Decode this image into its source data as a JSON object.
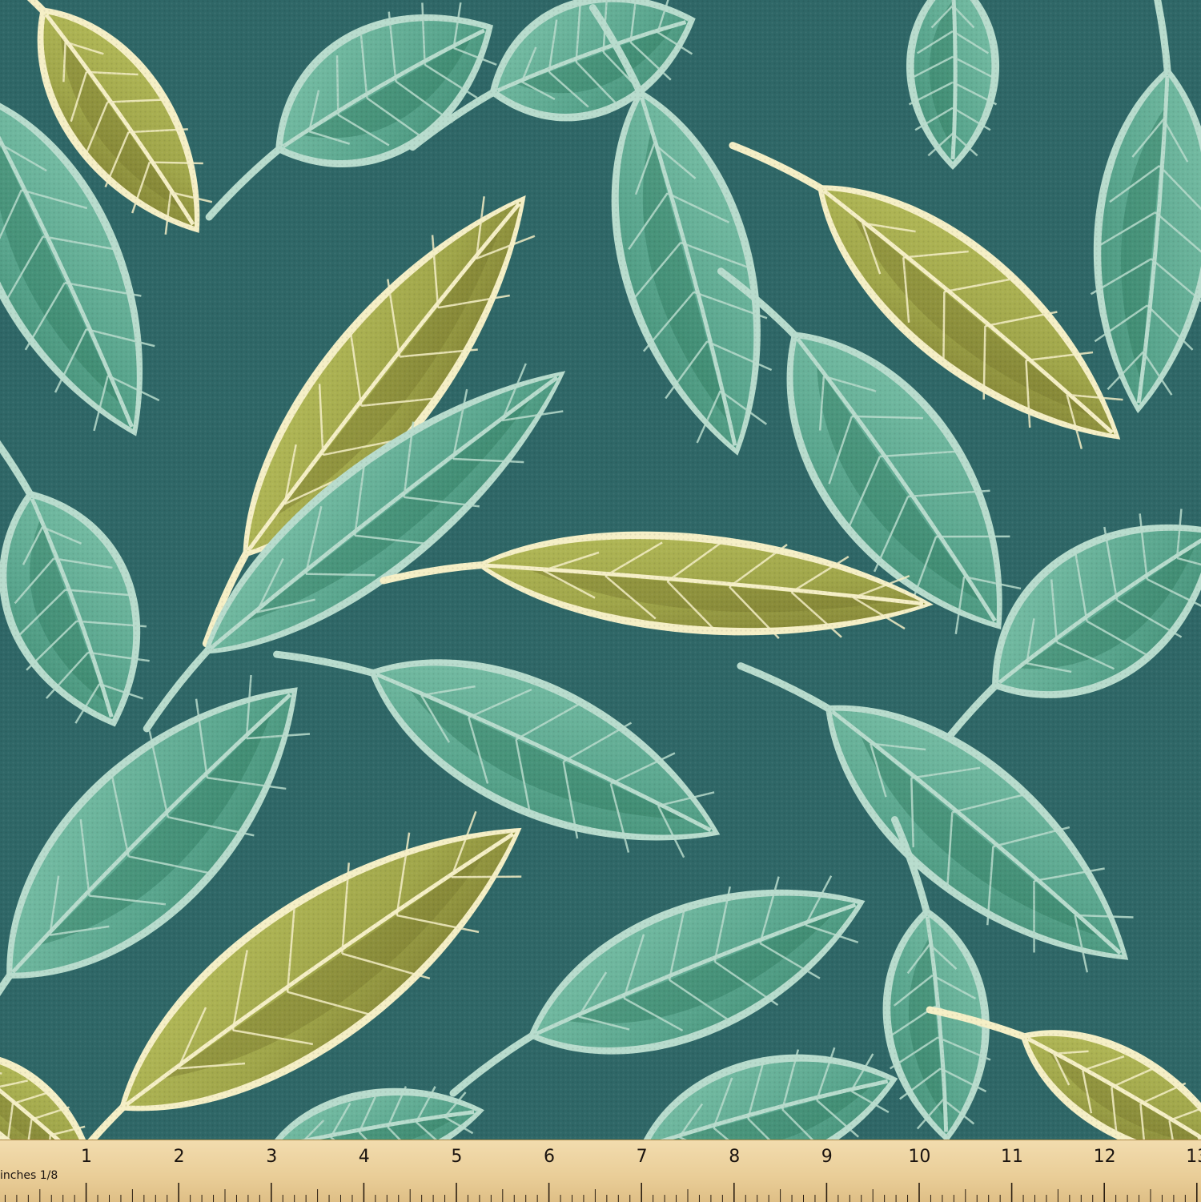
{
  "image": {
    "subject": "leaf pattern fabric swatch",
    "colors": {
      "background": "#2f6767",
      "teal_leaf": "#5aa68e",
      "teal_leaf_light": "#7cc2a9",
      "teal_vein": "#2f7a5f",
      "olive_leaf": "#a3ad4c",
      "olive_dark": "#7b7a2f",
      "leaf_rim": "#b8dccd",
      "cream_rim": "#f5efc6"
    }
  },
  "ruler": {
    "unit_label": "inches 1/8",
    "numbers": [
      "1",
      "2",
      "3",
      "4",
      "5",
      "6",
      "7",
      "8",
      "9",
      "10",
      "11",
      "12",
      "13"
    ]
  }
}
